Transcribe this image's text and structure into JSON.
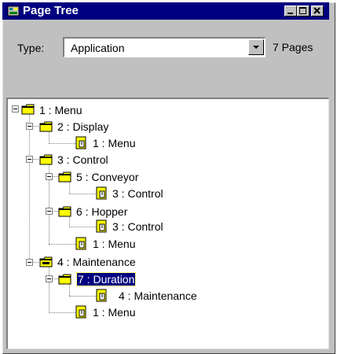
{
  "window": {
    "title": "Page Tree"
  },
  "toolbar": {
    "type_label": "Type:",
    "type_value": "Application",
    "page_count": "7 Pages"
  },
  "tree": [
    {
      "label": "1 : Menu"
    },
    {
      "label": "2 : Display"
    },
    {
      "label": "1 : Menu"
    },
    {
      "label": "3 : Control"
    },
    {
      "label": "5 : Conveyor"
    },
    {
      "label": "3 : Control"
    },
    {
      "label": "6 : Hopper"
    },
    {
      "label": "3 : Control"
    },
    {
      "label": "1 : Menu"
    },
    {
      "label": "4 : Maintenance"
    },
    {
      "label": "7 : Duration"
    },
    {
      "label": "4 : Maintenance"
    },
    {
      "label": "1 : Menu"
    }
  ],
  "colors": {
    "title_bar": "#000080",
    "window_face": "#c0c0c0",
    "folder_yellow": "#ffff00",
    "selection": "#000080"
  }
}
